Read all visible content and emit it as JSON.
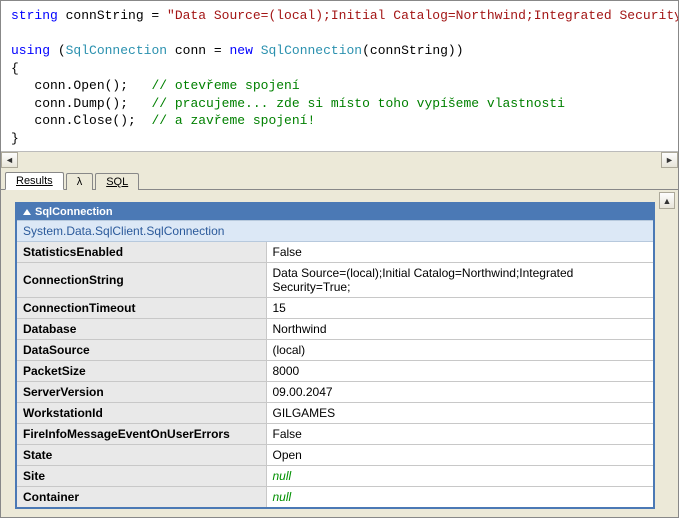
{
  "code": {
    "t": [
      {
        "kw": "string",
        "plain": " connString = ",
        "str": "\"Data Source=(local);Initial Catalog=Northwind;Integrated Security=True;\"",
        "end": ";"
      },
      {
        "raw": ""
      },
      {
        "kw": "using",
        "plain": " (",
        "type": "SqlConnection",
        "plain2": " conn = ",
        "kw2": "new",
        "plain3": " ",
        "type2": "SqlConnection",
        "plain4": "(connString))"
      },
      {
        "raw": "{"
      },
      {
        "indent": "   conn.Open();   ",
        "cmnt": "// otevřeme spojení"
      },
      {
        "indent": "   conn.Dump();   ",
        "cmnt": "// pracujeme... zde si místo toho vypíšeme vlastnosti"
      },
      {
        "indent": "   conn.Close();  ",
        "cmnt": "// a zavřeme spojení!"
      },
      {
        "raw": "}"
      }
    ]
  },
  "tabs": {
    "results": "Results",
    "lambda": "λ",
    "sql": "SQL"
  },
  "dump": {
    "title": "SqlConnection",
    "typename": "System.Data.SqlClient.SqlConnection",
    "rows": [
      {
        "k": "StatisticsEnabled",
        "v": "False"
      },
      {
        "k": "ConnectionString",
        "v": "Data Source=(local);Initial Catalog=Northwind;Integrated Security=True;"
      },
      {
        "k": "ConnectionTimeout",
        "v": "15"
      },
      {
        "k": "Database",
        "v": "Northwind"
      },
      {
        "k": "DataSource",
        "v": "(local)"
      },
      {
        "k": "PacketSize",
        "v": "8000"
      },
      {
        "k": "ServerVersion",
        "v": "09.00.2047"
      },
      {
        "k": "WorkstationId",
        "v": "GILGAMES"
      },
      {
        "k": "FireInfoMessageEventOnUserErrors",
        "v": "False"
      },
      {
        "k": "State",
        "v": "Open"
      },
      {
        "k": "Site",
        "v": "null",
        "null": true
      },
      {
        "k": "Container",
        "v": "null",
        "null": true
      }
    ]
  }
}
